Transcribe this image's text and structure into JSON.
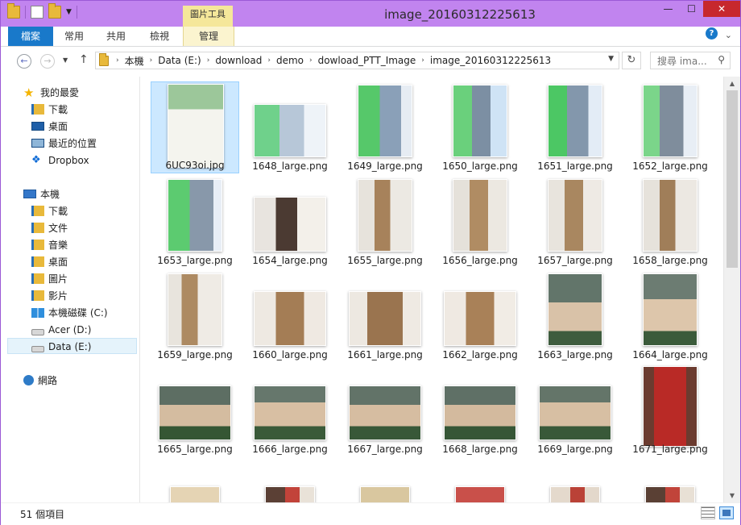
{
  "window": {
    "title": "image_20160312225613",
    "contextual_tab": "圖片工具",
    "controls": {
      "minimize": "—",
      "maximize": "☐",
      "close": "✕"
    }
  },
  "ribbon": {
    "tabs": [
      {
        "label": "檔案"
      },
      {
        "label": "常用"
      },
      {
        "label": "共用"
      },
      {
        "label": "檢視"
      },
      {
        "label": "管理"
      }
    ],
    "expand_icon": "chevron-down-icon",
    "help": "?"
  },
  "navigation": {
    "back": "←",
    "forward": "→",
    "up": "↑",
    "breadcrumb": [
      "本機",
      "Data (E:)",
      "download",
      "demo",
      "dowload_PTT_Image",
      "image_20160312225613"
    ],
    "refresh": "↻",
    "search_placeholder": "搜尋 ima..."
  },
  "sidebar": {
    "favorites": [
      {
        "label": "我的最愛",
        "icon": "star-icon"
      },
      {
        "label": "下載",
        "icon": "downloads-folder-icon"
      },
      {
        "label": "桌面",
        "icon": "desktop-icon"
      },
      {
        "label": "最近的位置",
        "icon": "recent-places-icon"
      },
      {
        "label": "Dropbox",
        "icon": "dropbox-icon"
      }
    ],
    "this_pc": [
      {
        "label": "本機",
        "icon": "computer-icon"
      },
      {
        "label": "下載",
        "icon": "downloads-folder-icon"
      },
      {
        "label": "文件",
        "icon": "documents-folder-icon"
      },
      {
        "label": "音樂",
        "icon": "music-folder-icon"
      },
      {
        "label": "桌面",
        "icon": "desktop-folder-icon"
      },
      {
        "label": "圖片",
        "icon": "pictures-folder-icon"
      },
      {
        "label": "影片",
        "icon": "videos-folder-icon"
      },
      {
        "label": "本機磁碟 (C:)",
        "icon": "windows-drive-icon"
      },
      {
        "label": "Acer (D:)",
        "icon": "drive-icon"
      },
      {
        "label": "Data (E:)",
        "icon": "drive-icon",
        "selected": true
      }
    ],
    "network": {
      "label": "網路",
      "icon": "network-icon"
    }
  },
  "files": [
    {
      "name": "6UC93oi.jpg",
      "selected": true
    },
    {
      "name": "1648_large.png"
    },
    {
      "name": "1649_large.png"
    },
    {
      "name": "1650_large.png"
    },
    {
      "name": "1651_large.png"
    },
    {
      "name": "1652_large.png"
    },
    {
      "name": "1653_large.png"
    },
    {
      "name": "1654_large.png"
    },
    {
      "name": "1655_large.png"
    },
    {
      "name": "1656_large.png"
    },
    {
      "name": "1657_large.png"
    },
    {
      "name": "1658_large.png"
    },
    {
      "name": "1659_large.png"
    },
    {
      "name": "1660_large.png"
    },
    {
      "name": "1661_large.png"
    },
    {
      "name": "1662_large.png"
    },
    {
      "name": "1663_large.png"
    },
    {
      "name": "1664_large.png"
    },
    {
      "name": "1665_large.png"
    },
    {
      "name": "1666_large.png"
    },
    {
      "name": "1667_large.png"
    },
    {
      "name": "1668_large.png"
    },
    {
      "name": "1669_large.png"
    },
    {
      "name": "1671_large.png"
    },
    {
      "name": ""
    },
    {
      "name": ""
    },
    {
      "name": ""
    },
    {
      "name": ""
    },
    {
      "name": ""
    },
    {
      "name": ""
    }
  ],
  "status": {
    "item_count": "51 個項目"
  },
  "colors": {
    "title_bar": "#c184ef",
    "file_tab": "#1979ca",
    "picture_tools": "#f5e79a",
    "selection": "#cce8ff",
    "close_button": "#c7282e"
  }
}
